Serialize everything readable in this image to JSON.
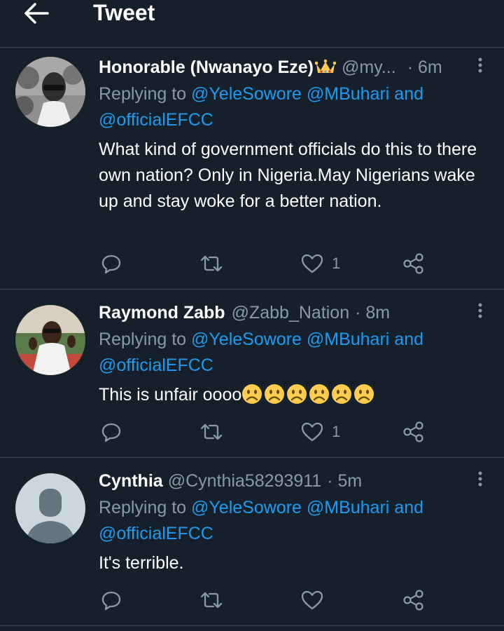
{
  "header": {
    "title": "Tweet"
  },
  "tweets": [
    {
      "name": "Honorable (Nwanayo Eze)",
      "handle": "@my...",
      "time": "· 6m",
      "replying_prefix": "Replying to ",
      "mentions_line1": "@YeleSowore @MBuhari",
      "and": " and",
      "mentions_line2": "@officialEFCC",
      "text": "What kind of government officials do this to there own nation? Only in Nigeria.May Nigerians wake up and stay woke for a better nation.",
      "likes": "1"
    },
    {
      "name": "Raymond Zabb",
      "handle": "@Zabb_Nation",
      "time": "· 8m",
      "replying_prefix": "Replying to ",
      "mentions_line1": "@YeleSowore @MBuhari",
      "and": " and",
      "mentions_line2": "@officialEFCC",
      "text": "This is unfair oooo",
      "likes": "1"
    },
    {
      "name": "Cynthia",
      "handle": "@Cynthia58293911",
      "time": "· 5m",
      "replying_prefix": "Replying to ",
      "mentions_line1": "@YeleSowore @MBuhari",
      "and": " and",
      "mentions_line2": "@officialEFCC",
      "text": "It's terrible.",
      "likes": ""
    }
  ],
  "icons": {
    "back": "arrow-left-icon",
    "more": "more-vertical-icon",
    "reply": "reply-icon",
    "retweet": "retweet-icon",
    "like": "heart-icon",
    "share": "share-icon",
    "crown": "crown-emoji",
    "frown": "frowning-face-emoji"
  },
  "colors": {
    "background": "#15202b",
    "divider": "#38444d",
    "muted": "#8b98a5",
    "link": "#1d9bf0",
    "emoji": "#ffcc4d"
  }
}
